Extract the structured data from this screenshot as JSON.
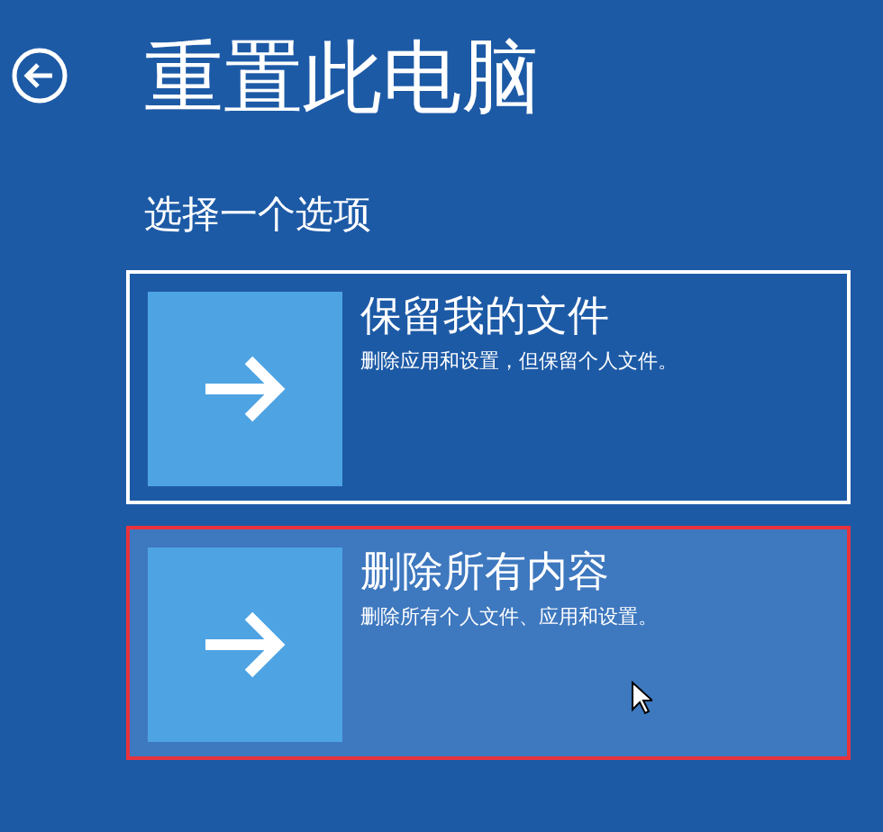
{
  "title": "重置此电脑",
  "subtitle": "选择一个选项",
  "options": [
    {
      "title": "保留我的文件",
      "description": "删除应用和设置，但保留个人文件。",
      "selected": true,
      "hovered": false
    },
    {
      "title": "删除所有内容",
      "description": "删除所有个人文件、应用和设置。",
      "selected": false,
      "hovered": true
    }
  ]
}
